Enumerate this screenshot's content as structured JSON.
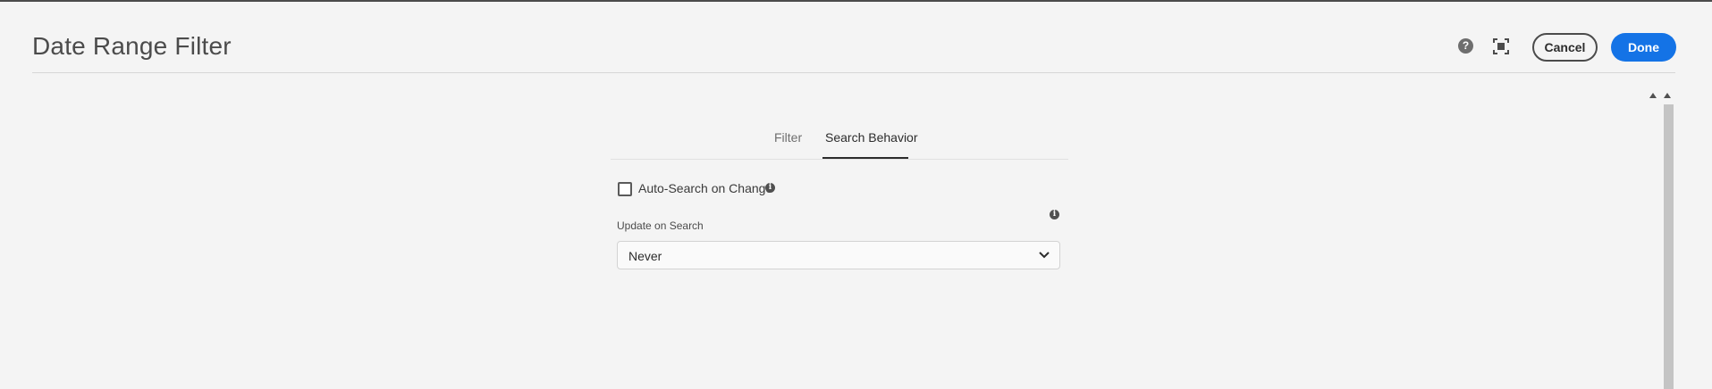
{
  "dialog": {
    "title": "Date Range Filter",
    "help_icon": "help-icon",
    "fullscreen_icon": "fullscreen-icon",
    "cancel_label": "Cancel",
    "done_label": "Done"
  },
  "tabs": [
    {
      "label": "Filter",
      "selected": false
    },
    {
      "label": "Search Behavior",
      "selected": true
    }
  ],
  "search_behavior": {
    "auto_search_label": "Auto-Search on Change",
    "auto_search_checked": false,
    "update_on_search_label": "Update on Search",
    "update_on_search_value": "Never"
  },
  "colors": {
    "accent": "#1473e6",
    "background": "#f4f4f4",
    "text": "#2c2c2c"
  }
}
